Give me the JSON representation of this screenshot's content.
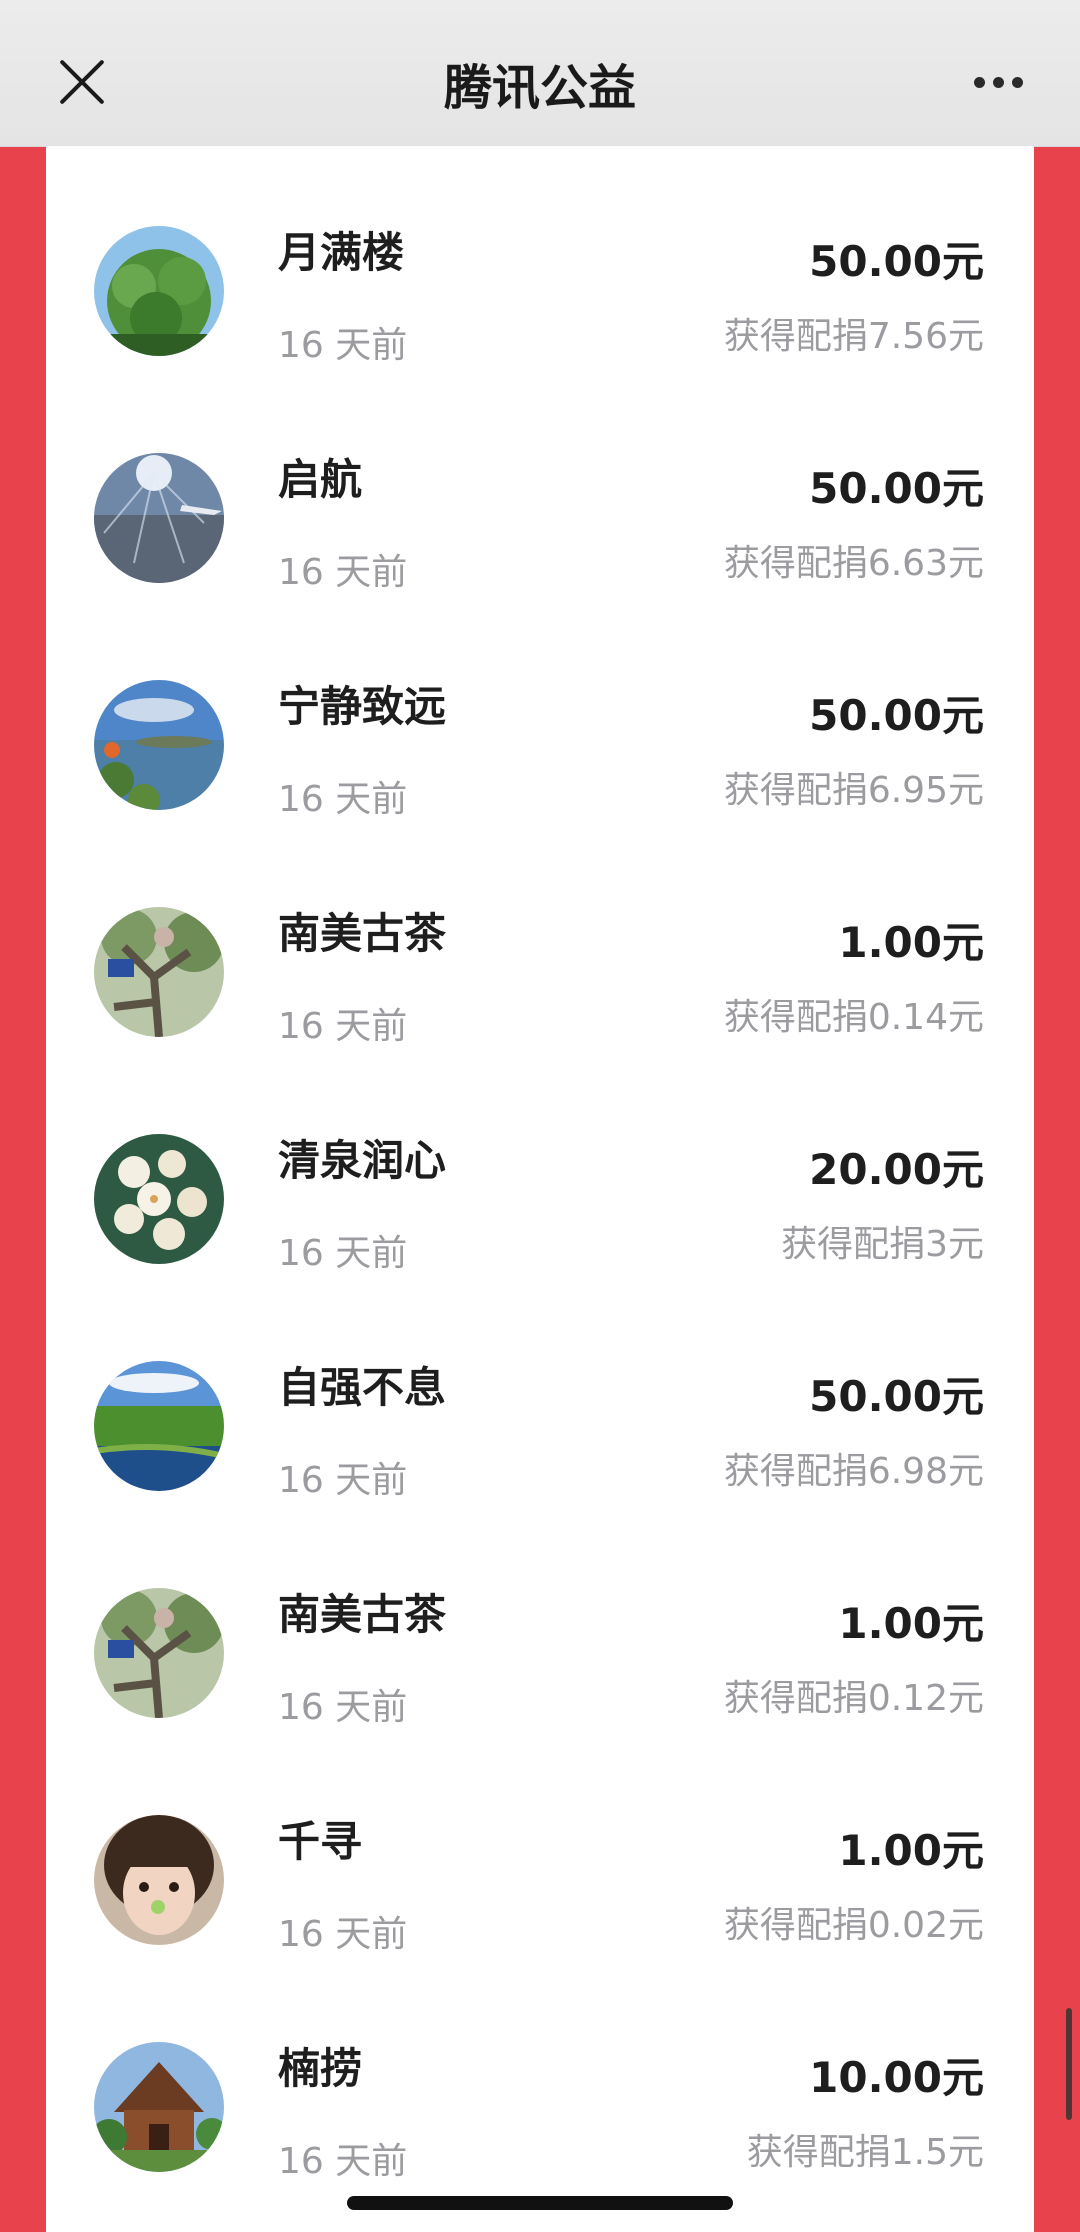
{
  "header": {
    "title": "腾讯公益"
  },
  "donations": [
    {
      "name": "月满楼",
      "time": "16 天前",
      "amount": "50.00元",
      "match": "获得配捐7.56元",
      "avatar_icon": "tree-photo-icon"
    },
    {
      "name": "启航",
      "time": "16 天前",
      "amount": "50.00元",
      "match": "获得配捐6.63元",
      "avatar_icon": "airplane-sky-photo-icon"
    },
    {
      "name": "宁静致远",
      "time": "16 天前",
      "amount": "50.00元",
      "match": "获得配捐6.95元",
      "avatar_icon": "lake-island-photo-icon"
    },
    {
      "name": "南美古茶",
      "time": "16 天前",
      "amount": "1.00元",
      "match": "获得配捐0.14元",
      "avatar_icon": "old-tea-tree-photo-icon"
    },
    {
      "name": "清泉润心",
      "time": "16 天前",
      "amount": "20.00元",
      "match": "获得配捐3元",
      "avatar_icon": "white-flowers-photo-icon"
    },
    {
      "name": "自强不息",
      "time": "16 天前",
      "amount": "50.00元",
      "match": "获得配捐6.98元",
      "avatar_icon": "grassland-river-photo-icon"
    },
    {
      "name": "南美古茶",
      "time": "16 天前",
      "amount": "1.00元",
      "match": "获得配捐0.12元",
      "avatar_icon": "old-tea-tree-photo-icon"
    },
    {
      "name": "千寻",
      "time": "16 天前",
      "amount": "1.00元",
      "match": "获得配捐0.02元",
      "avatar_icon": "girl-portrait-photo-icon"
    },
    {
      "name": "楠捞",
      "time": "16 天前",
      "amount": "10.00元",
      "match": "获得配捐1.5元",
      "avatar_icon": "temple-building-photo-icon"
    }
  ],
  "colors": {
    "accent_red": "#e8424d",
    "text_primary": "#1e1e1e",
    "text_secondary": "#9b9ba0"
  }
}
